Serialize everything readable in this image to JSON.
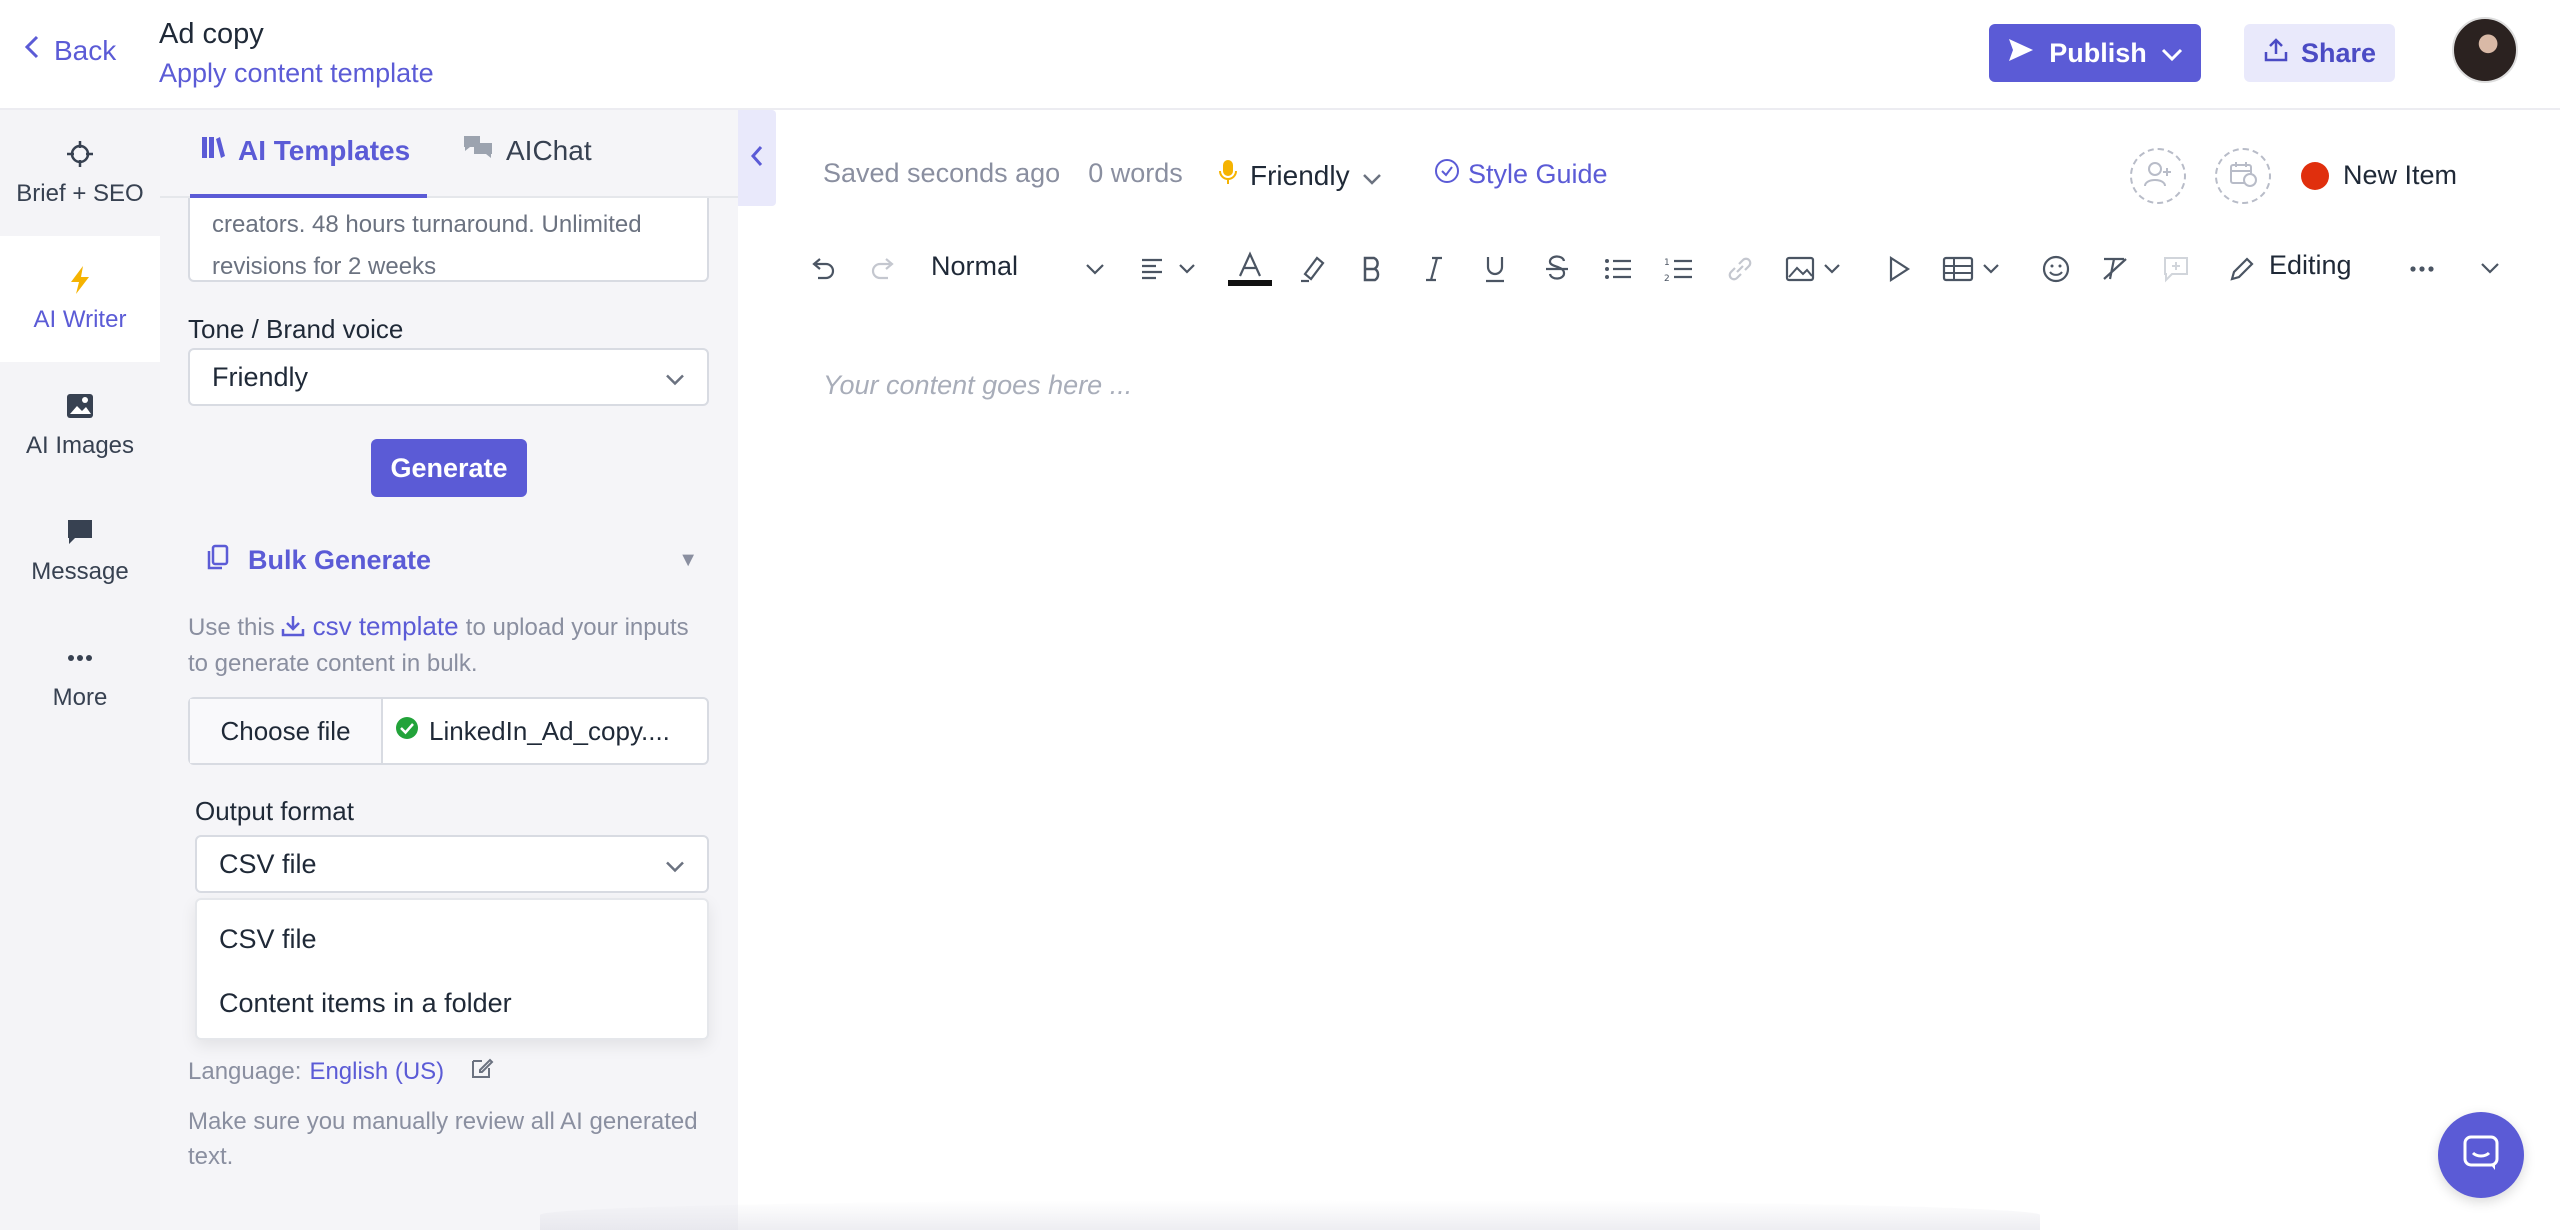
{
  "header": {
    "back_label": "Back",
    "doc_title": "Ad copy",
    "apply_template_link": "Apply content template",
    "publish_label": "Publish",
    "share_label": "Share"
  },
  "leftnav": {
    "items": [
      {
        "label": "Brief + SEO",
        "icon": "crosshair-icon"
      },
      {
        "label": "AI Writer",
        "icon": "lightning-icon",
        "active": true
      },
      {
        "label": "AI Images",
        "icon": "image-icon"
      },
      {
        "label": "Message",
        "icon": "message-icon"
      },
      {
        "label": "More",
        "icon": "more-icon"
      }
    ]
  },
  "panel": {
    "tabs": [
      {
        "label": "AI Templates",
        "active": true
      },
      {
        "label": "AIChat"
      }
    ],
    "description_text": "creators. 48 hours turnaround. Unlimited revisions for 2 weeks",
    "tone_label": "Tone / Brand voice",
    "tone_value": "Friendly",
    "generate_label": "Generate",
    "bulk_label": "Bulk Generate",
    "bulk_help_prefix": "Use this",
    "bulk_help_link": "csv template",
    "bulk_help_suffix": "to upload your inputs to generate content in bulk.",
    "choose_file_label": "Choose file",
    "file_name": "LinkedIn_Ad_copy....",
    "output_format_label": "Output format",
    "output_format_value": "CSV file",
    "output_options": [
      "CSV file",
      "Content items in a folder"
    ],
    "language_label": "Language:",
    "language_value": "English (US)",
    "review_note": "Make sure you manually review all AI generated text."
  },
  "editor": {
    "saved_status": "Saved seconds ago",
    "word_count": "0 words",
    "voice": "Friendly",
    "style_guide": "Style Guide",
    "new_item": "New Item",
    "paragraph_style": "Normal",
    "mode": "Editing",
    "placeholder": "Your content goes here ..."
  },
  "colors": {
    "accent": "#5b5bd6",
    "status_red": "#e02f0d",
    "success_green": "#22a33a"
  }
}
